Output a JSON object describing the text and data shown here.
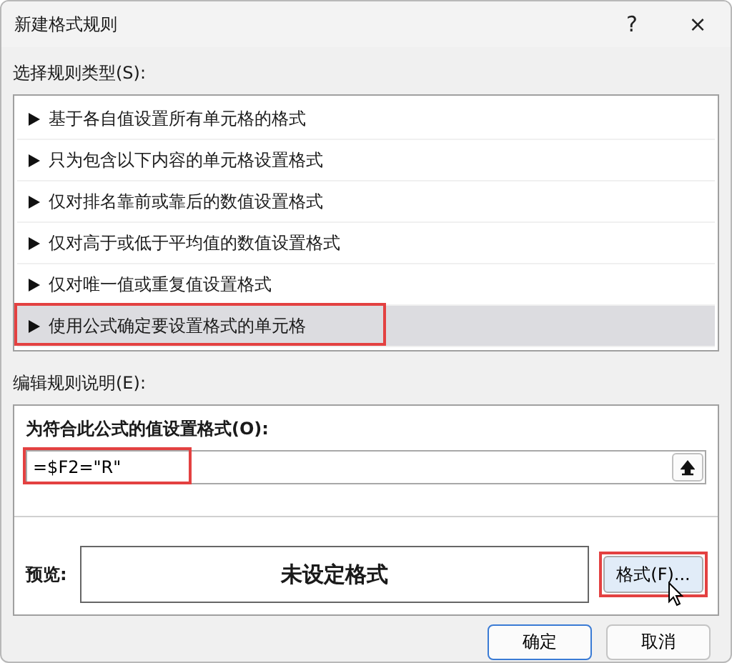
{
  "window": {
    "title": "新建格式规则",
    "help": "?",
    "close": "×"
  },
  "rule_type_label": "选择规则类型(S):",
  "rule_types": [
    {
      "label": "基于各自值设置所有单元格的格式",
      "selected": false,
      "highlighted": false
    },
    {
      "label": "只为包含以下内容的单元格设置格式",
      "selected": false,
      "highlighted": false
    },
    {
      "label": "仅对排名靠前或靠后的数值设置格式",
      "selected": false,
      "highlighted": false
    },
    {
      "label": "仅对高于或低于平均值的数值设置格式",
      "selected": false,
      "highlighted": false
    },
    {
      "label": "仅对唯一值或重复值设置格式",
      "selected": false,
      "highlighted": false
    },
    {
      "label": "使用公式确定要设置格式的单元格",
      "selected": true,
      "highlighted": true
    }
  ],
  "description_label": "编辑规则说明(E):",
  "formula_label": "为符合此公式的值设置格式(O):",
  "formula": {
    "value": "=$F2=\"R\"",
    "highlighted": true
  },
  "preview": {
    "label": "预览:",
    "text": "未设定格式"
  },
  "format_button": {
    "label": "格式(F)...",
    "highlighted": true
  },
  "buttons": [
    {
      "label": "确定",
      "default": true
    },
    {
      "label": "取消",
      "default": false
    }
  ]
}
